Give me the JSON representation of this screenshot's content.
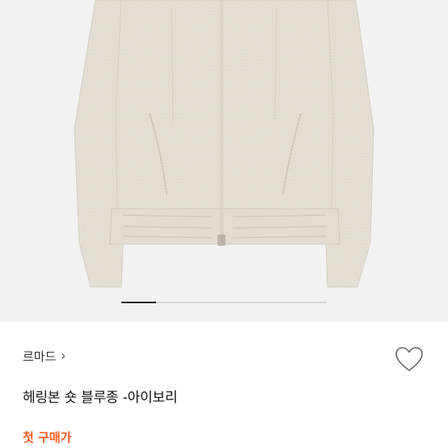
{
  "product": {
    "brand": "르마드",
    "brand_chevron_icon": "chevron-right-icon",
    "title": "헤링본 숏 블루종 -아이보리",
    "promo_label": "첫 구매가",
    "promo_color": "#ff5a1f",
    "like_icon": "heart-outline-icon"
  },
  "gallery": {
    "image_subject": "jacket-photo",
    "pager_progress": 0.17
  },
  "colors": {
    "background": "#ffffff",
    "photo_bg": "#f3f2f0",
    "fabric": "#e7e2d8",
    "text": "#111111"
  }
}
